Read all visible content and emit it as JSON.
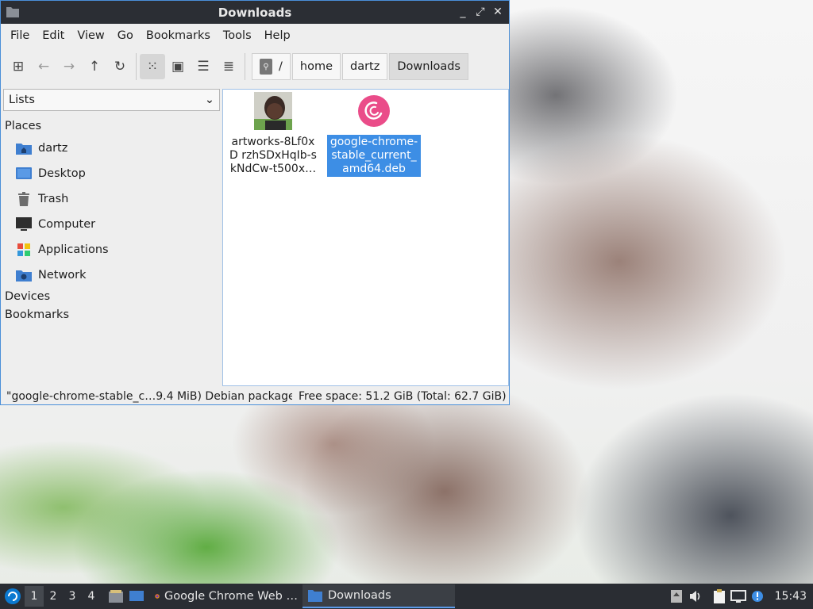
{
  "window": {
    "title": "Downloads",
    "controls": {
      "minimize": "_",
      "maximize": "⤢",
      "close": "✕"
    }
  },
  "menubar": [
    "File",
    "Edit",
    "View",
    "Go",
    "Bookmarks",
    "Tools",
    "Help"
  ],
  "toolbar": {
    "buttons": [
      {
        "name": "new-window-icon",
        "glyph": "⊞",
        "enabled": true
      },
      {
        "name": "back-arrow-icon",
        "glyph": "←",
        "enabled": false
      },
      {
        "name": "forward-arrow-icon",
        "glyph": "→",
        "enabled": false
      },
      {
        "name": "up-arrow-icon",
        "glyph": "↑",
        "enabled": true
      },
      {
        "name": "reload-icon",
        "glyph": "↻",
        "enabled": true
      }
    ],
    "views": [
      {
        "name": "icon-view-icon",
        "glyph": "⁙",
        "active": true
      },
      {
        "name": "thumbnail-view-icon",
        "glyph": "▣",
        "active": false
      },
      {
        "name": "compact-view-icon",
        "glyph": "☰",
        "active": false
      },
      {
        "name": "detailed-list-view-icon",
        "glyph": "≣",
        "active": false
      }
    ]
  },
  "breadcrumbs": [
    "/",
    "home",
    "dartz",
    "Downloads"
  ],
  "side_panel": {
    "selector": "Lists",
    "places_heading": "Places",
    "places": [
      {
        "label": "dartz",
        "icon": "home-folder-icon",
        "color": "#3f7fd0"
      },
      {
        "label": "Desktop",
        "icon": "desktop-icon",
        "color": "#3f7fd0"
      },
      {
        "label": "Trash",
        "icon": "trash-icon",
        "color": "#6d6d6d"
      },
      {
        "label": "Computer",
        "icon": "computer-icon",
        "color": "#2e2e2e"
      },
      {
        "label": "Applications",
        "icon": "applications-icon",
        "color": "#e74c3c"
      },
      {
        "label": "Network",
        "icon": "network-folder-icon",
        "color": "#3f7fd0"
      }
    ],
    "devices_heading": "Devices",
    "bookmarks_heading": "Bookmarks"
  },
  "files": [
    {
      "name": "artworks-8Lf0xD rzhSDxHqIb-skNdCw-t500x…",
      "type": "image-thumbnail",
      "selected": false
    },
    {
      "name": "google-chrome-stable_current_amd64.deb",
      "type": "debian-package",
      "selected": true
    }
  ],
  "status": {
    "selection": "\"google-chrome-stable_c…9.4 MiB) Debian package",
    "free_space": "Free space: 51.2 GiB (Total: 62.7 GiB)"
  },
  "taskbar": {
    "workspaces": [
      "1",
      "2",
      "3",
      "4"
    ],
    "active_workspace": "1",
    "tasks": [
      {
        "label": "Google Chrome Web …",
        "icon": "firefox-icon",
        "active": false
      },
      {
        "label": "Downloads",
        "icon": "folder-icon",
        "active": true
      }
    ],
    "clock": "15:43"
  },
  "colors": {
    "accent": "#3d8ee5",
    "titlebar": "#2b2e34",
    "taskbar": "#2a2d33",
    "debian_red": "#d70751"
  }
}
